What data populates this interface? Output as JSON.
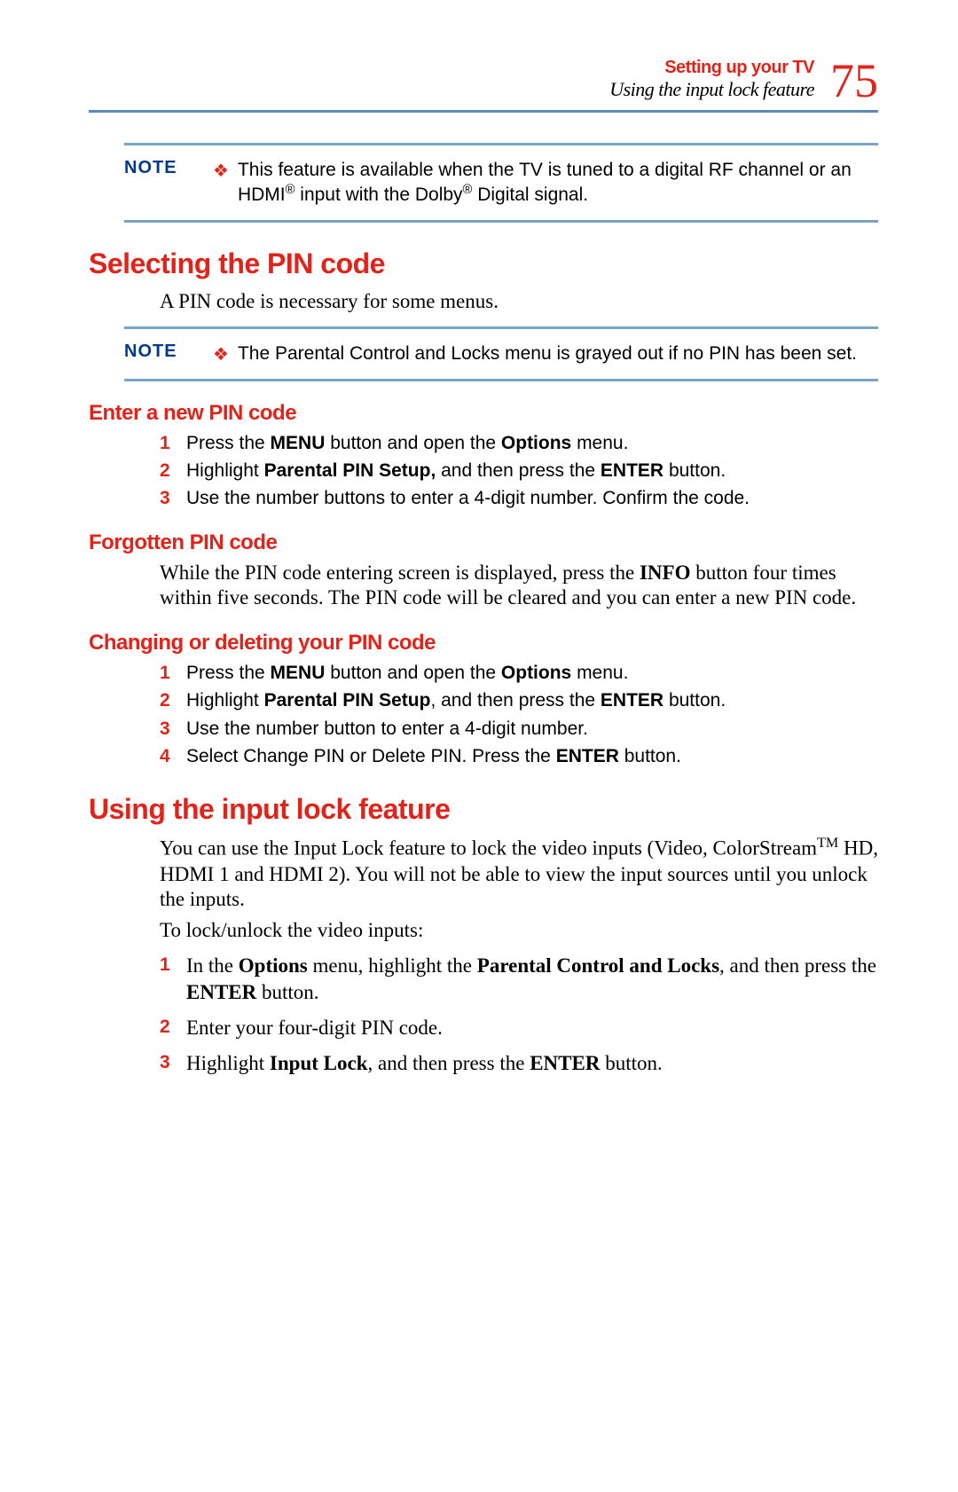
{
  "header": {
    "chapter": "Setting up your TV",
    "section_italic": "Using the input lock feature",
    "page_number": "75"
  },
  "note1": {
    "label": "NOTE",
    "text_before": "This feature is available when the TV is tuned to a digital RF channel or an HDMI",
    "text_mid": " input with the Dolby",
    "text_after": " Digital signal."
  },
  "section_pin": {
    "heading": "Selecting the PIN code",
    "intro": "A PIN code is necessary for some menus."
  },
  "note2": {
    "label": "NOTE",
    "text": "The Parental Control and Locks menu is grayed out if no PIN has been set."
  },
  "enter_new": {
    "heading": "Enter a new PIN code",
    "steps": [
      {
        "n": "1",
        "pre": "Press the ",
        "b1": "MENU",
        "mid": " button and open the ",
        "b2": "Options",
        "post": " menu."
      },
      {
        "n": "2",
        "pre": "Highlight ",
        "b1": "Parental PIN Setup,",
        "mid": " and then press the ",
        "b2": "ENTER",
        "post": " button."
      },
      {
        "n": "3",
        "pre": "Use the number buttons to enter a 4-digit number. Confirm the code.",
        "b1": "",
        "mid": "",
        "b2": "",
        "post": ""
      }
    ]
  },
  "forgotten": {
    "heading": "Forgotten PIN code",
    "p_pre": "While the PIN code entering screen is displayed, press the ",
    "p_b": "INFO",
    "p_post": " button four times within five seconds. The PIN code will be cleared and you can enter a new PIN code."
  },
  "change_delete": {
    "heading": "Changing or deleting your PIN code",
    "steps": [
      {
        "n": "1",
        "pre": "Press the ",
        "b1": "MENU",
        "mid": " button and open the ",
        "b2": "Options",
        "post": " menu."
      },
      {
        "n": "2",
        "pre": "Highlight ",
        "b1": "Parental PIN Setup",
        "mid": ", and then press the ",
        "b2": "ENTER",
        "post": " button."
      },
      {
        "n": "3",
        "pre": "Use the number button to enter a 4-digit number.",
        "b1": "",
        "mid": "",
        "b2": "",
        "post": ""
      },
      {
        "n": "4",
        "pre": "Select Change PIN or Delete PIN. Press the ",
        "b1": "ENTER",
        "mid": " button.",
        "b2": "",
        "post": ""
      }
    ]
  },
  "input_lock": {
    "heading": "Using the input lock feature",
    "p1_pre": "You can use the Input Lock feature to lock the video inputs (Video, ColorStream",
    "p1_post": " HD, HDMI 1 and HDMI 2). You will not be able to view the input sources until you unlock the inputs.",
    "p2": "To lock/unlock the video inputs:",
    "steps": [
      {
        "n": "1",
        "pre": "In the ",
        "b1": "Options",
        "mid": " menu, highlight the ",
        "b2": "Parental Control and Locks",
        "mid2": ", and then press the ",
        "b3": "ENTER",
        "post": " button."
      },
      {
        "n": "2",
        "pre": "Enter your four-digit PIN code.",
        "b1": "",
        "mid": "",
        "b2": "",
        "mid2": "",
        "b3": "",
        "post": ""
      },
      {
        "n": "3",
        "pre": "Highlight ",
        "b1": "Input Lock",
        "mid": ", and then press the ",
        "b2": "ENTER",
        "mid2": " button.",
        "b3": "",
        "post": ""
      }
    ]
  }
}
